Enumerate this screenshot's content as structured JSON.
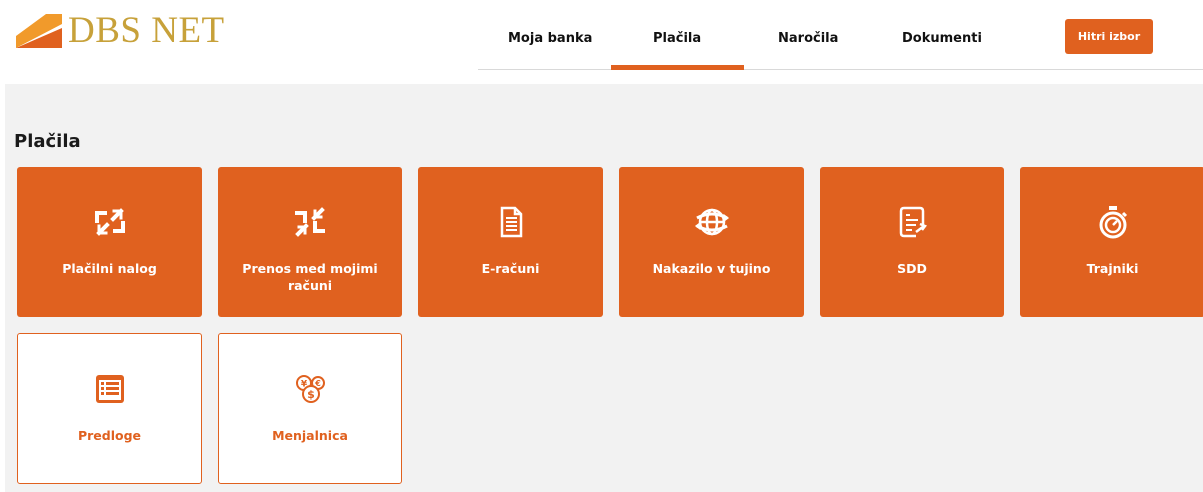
{
  "brand": {
    "logo_text": "DBS NET",
    "logo_color": "#c7a13a",
    "logo_mark_color": "#e0611f"
  },
  "colors": {
    "accent": "#e0611f",
    "background_main": "#f2f2f2"
  },
  "nav": {
    "items": [
      {
        "label": "Moja banka",
        "active": false
      },
      {
        "label": "Plačila",
        "active": true
      },
      {
        "label": "Naročila",
        "active": false
      },
      {
        "label": "Dokumenti",
        "active": false
      }
    ],
    "quick_button_label": "Hitri izbor"
  },
  "page": {
    "title": "Plačila"
  },
  "tiles": [
    {
      "label": "Plačilni nalog",
      "icon": "expand-arrows-icon",
      "style": "filled"
    },
    {
      "label": "Prenos med mojimi računi",
      "icon": "compress-arrows-icon",
      "style": "filled"
    },
    {
      "label": "E-računi",
      "icon": "document-icon",
      "style": "filled"
    },
    {
      "label": "Nakazilo v tujino",
      "icon": "globe-transfer-icon",
      "style": "filled"
    },
    {
      "label": "SDD",
      "icon": "scroll-document-icon",
      "style": "filled"
    },
    {
      "label": "Trajniki",
      "icon": "stopwatch-icon",
      "style": "filled"
    },
    {
      "label": "Predloge",
      "icon": "list-template-icon",
      "style": "outline"
    },
    {
      "label": "Menjalnica",
      "icon": "currency-exchange-icon",
      "style": "outline"
    }
  ]
}
